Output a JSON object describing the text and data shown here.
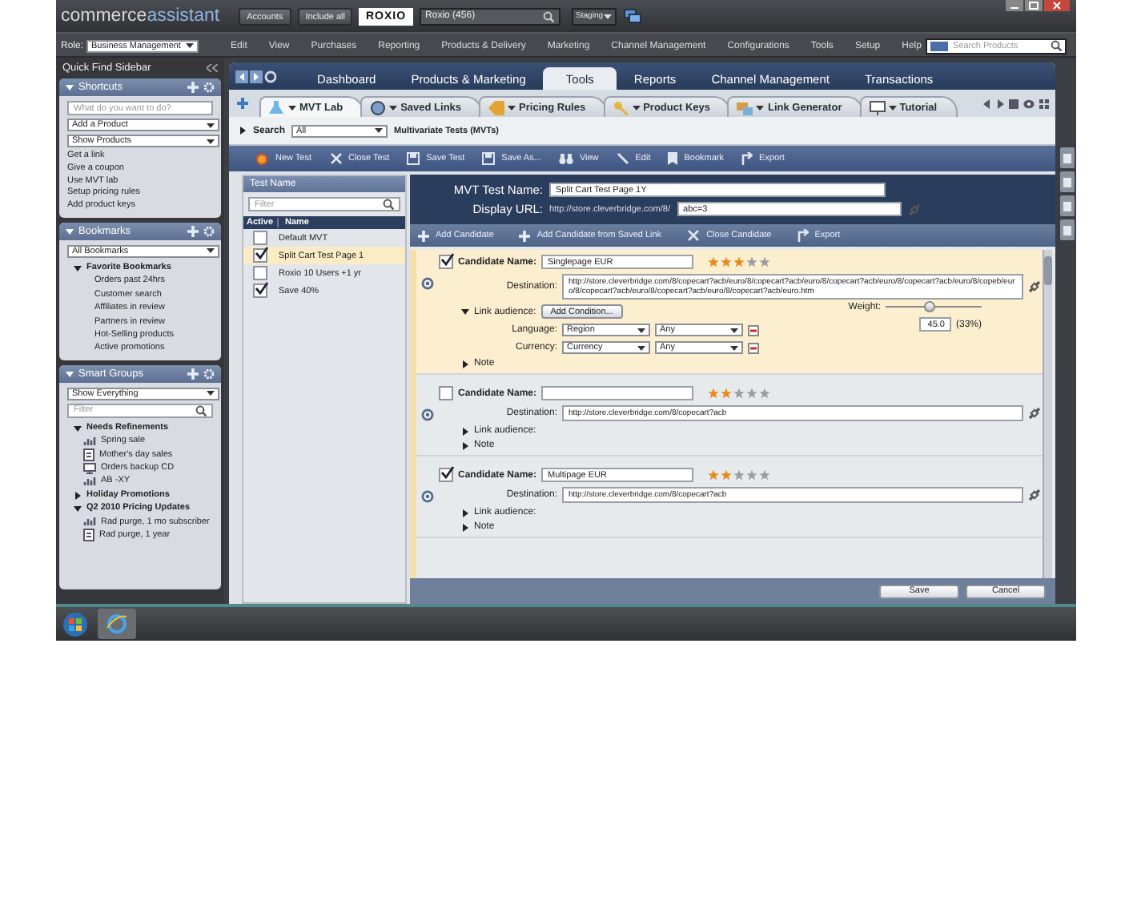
{
  "top_bar": {
    "logo": {
      "first": "commerce",
      "second": "assistant"
    },
    "accounts_button": "Accounts",
    "include_all_button": "Include all",
    "brand_logo": "ROXIO",
    "account_search": {
      "value": "Roxio (456)"
    },
    "environment": "Staging"
  },
  "menu_bar": {
    "role_label": "Role:",
    "role": "Business Management",
    "items": [
      "Edit",
      "View",
      "Purchases",
      "Reporting",
      "Products & Delivery",
      "Marketing",
      "Channel Management",
      "Configurations",
      "Tools",
      "Setup",
      "Help"
    ],
    "search": {
      "placeholder": "Search Products"
    }
  },
  "sidebar": {
    "title": "Quick Find Sidebar",
    "shortcuts": {
      "title": "Shortcuts",
      "expanded": true,
      "search": {
        "placeholder": "What do you want to do?"
      },
      "selects": [
        "Add a Product",
        "Show Products"
      ],
      "links": [
        "Get a link",
        "Give a coupon",
        "Use MVT lab",
        "Setup pricing rules",
        "Add product keys"
      ]
    },
    "bookmarks": {
      "title": "Bookmarks",
      "expanded": true,
      "select": "All Bookmarks",
      "tree": [
        {
          "label": "Favorite Bookmarks",
          "expanded": true,
          "children": [
            {
              "label": "Orders past 24hrs"
            },
            {
              "label": "Customer search"
            },
            {
              "label": "Affiliates in review"
            },
            {
              "label": "Partners in review"
            },
            {
              "label": "Hot-Selling products"
            },
            {
              "label": "Active promotions"
            }
          ]
        }
      ]
    },
    "smart_groups": {
      "title": "Smart Groups",
      "expanded": true,
      "select": "Show Everything",
      "filter": {
        "placeholder": "Filter"
      },
      "tree": [
        {
          "label": "Needs Refinements",
          "expanded": true,
          "children": [
            {
              "label": "Spring sale"
            },
            {
              "label": "Mother's day sales"
            },
            {
              "label": "Orders backup CD"
            },
            {
              "label": "AB -XY"
            }
          ]
        },
        {
          "label": "Holiday Promotions",
          "expanded": false
        },
        {
          "label": "Q2 2010 Pricing Updates",
          "expanded": true,
          "children": [
            {
              "label": "Rad purge, 1 mo subscriber"
            },
            {
              "label": "Rad purge, 1 year"
            }
          ]
        }
      ]
    }
  },
  "main_tabs": [
    {
      "label": "Dashboard",
      "selected": false
    },
    {
      "label": "Products & Marketing",
      "selected": false
    },
    {
      "label": "Tools",
      "selected": true
    },
    {
      "label": "Reports",
      "selected": false
    },
    {
      "label": "Channel Management",
      "selected": false
    },
    {
      "label": "Transactions",
      "selected": false
    }
  ],
  "sub_tabs": [
    {
      "label": "MVT Lab",
      "selected": true
    },
    {
      "label": "Saved Links",
      "selected": false
    },
    {
      "label": "Pricing Rules",
      "selected": false
    },
    {
      "label": "Product Keys",
      "selected": false
    },
    {
      "label": "Link Generator",
      "selected": false
    },
    {
      "label": "Tutorial",
      "selected": false
    }
  ],
  "search_bar": {
    "label": "Search",
    "expanded": false,
    "scope": "All",
    "title": "Multivariate Tests (MVTs)"
  },
  "toolbar": [
    "New Test",
    "Close Test",
    "Save Test",
    "Save As...",
    "View",
    "Edit",
    "Bookmark",
    "Export"
  ],
  "test_list": {
    "title": "Test Name",
    "filter": {
      "placeholder": "Filter"
    },
    "columns": [
      "Active",
      "Name"
    ],
    "rows": [
      {
        "name": "Default MVT",
        "active": false,
        "selected": false
      },
      {
        "name": "Split Cart Test Page 1",
        "active": true,
        "selected": true
      },
      {
        "name": "Roxio 10 Users +1 yr",
        "active": false,
        "selected": false
      },
      {
        "name": "Save 40%",
        "active": true,
        "selected": false
      }
    ]
  },
  "test_detail": {
    "name_label": "MVT Test Name:",
    "name": "Split Cart Test Page 1Y",
    "url_label": "Display URL:",
    "url": "http://store.cleverbridge.com/8/",
    "url_param": "abc=3"
  },
  "candidate_toolbar": [
    "Add Candidate",
    "Add Candidate from Saved Link",
    "Close Candidate",
    "Export"
  ],
  "candidates": [
    {
      "selected": true,
      "checked": true,
      "name_label": "Candidate Name:",
      "name": "Singlepage EUR",
      "stars": 3,
      "destination_label": "Destination:",
      "destination": "http://store.cleverbridge.com/8/copecart?acb/euro/8/copecart?acb/euro/8/copecart?acb/euro/8/copecart?acb/euro/8/copeb/euro/8/copecart?acb/euro/8/copecart?acb/euro/8/copecart?acb/euro.htm",
      "audience_label": "Link audience:",
      "audience_expanded": true,
      "add_condition": "Add Condition...",
      "conditions": [
        {
          "label": "Language:",
          "field": "Region",
          "value": "Any"
        },
        {
          "label": "Currency:",
          "field": "Currency",
          "value": "Any"
        }
      ],
      "weight_label": "Weight:",
      "weight": {
        "level": 0.45
      },
      "weight_value": "45.0",
      "weight_share": "(33%)",
      "note_label": "Note",
      "note_expanded": false
    },
    {
      "selected": false,
      "checked": false,
      "name_label": "Candidate Name:",
      "stars": 2,
      "destination_label": "Destination:",
      "destination": "http://store.cleverbridge.com/8/copecart?acb",
      "audience_label": "Link audience:",
      "audience_expanded": false,
      "note_label": "Note",
      "note_expanded": false
    },
    {
      "selected": false,
      "checked": true,
      "name_label": "Candidate Name:",
      "name": "Multipage EUR",
      "stars": 2,
      "destination_label": "Destination:",
      "destination": "http://store.cleverbridge.com/8/copecart?acb",
      "audience_label": "Link audience:",
      "audience_expanded": false,
      "note_label": "Note",
      "note_expanded": false
    }
  ],
  "footer_buttons": [
    "Save",
    "Cancel"
  ]
}
